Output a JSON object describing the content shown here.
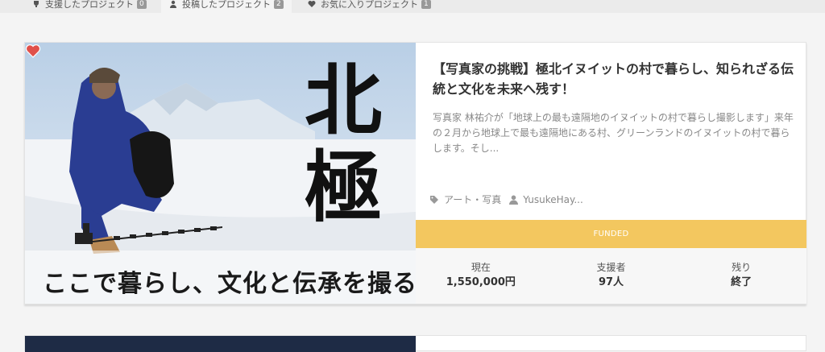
{
  "tabs": [
    {
      "label": "支援したプロジェクト",
      "count": "0",
      "icon": "trophy-icon"
    },
    {
      "label": "投稿したプロジェクト",
      "count": "2",
      "icon": "user-icon"
    },
    {
      "label": "お気に入りプロジェクト",
      "count": "1",
      "icon": "heart-icon"
    }
  ],
  "project": {
    "image_title": "北極",
    "image_caption": "ここで暮らし、文化と伝承を撮る",
    "title": "【写真家の挑戦】極北イヌイットの村で暮らし、知られざる伝統と文化を未来へ残す！",
    "description": "写真家 林祐介が「地球上の最も遠隔地のイヌイットの村で暮らし撮影します」来年の２月から地球上で最も遠隔地にある村、グリーンランドのイヌイットの村で暮らします。そし...",
    "category": "アート・写真",
    "author": "YusukeHay...",
    "status": "FUNDED",
    "stats": [
      {
        "label": "現在",
        "value": "1,550,000円"
      },
      {
        "label": "支援者",
        "value": "97人"
      },
      {
        "label": "残り",
        "value": "終了"
      }
    ]
  },
  "colors": {
    "funded_bar": "#f3c75f",
    "heart": "#e0504a",
    "background": "#f4f4f4"
  }
}
